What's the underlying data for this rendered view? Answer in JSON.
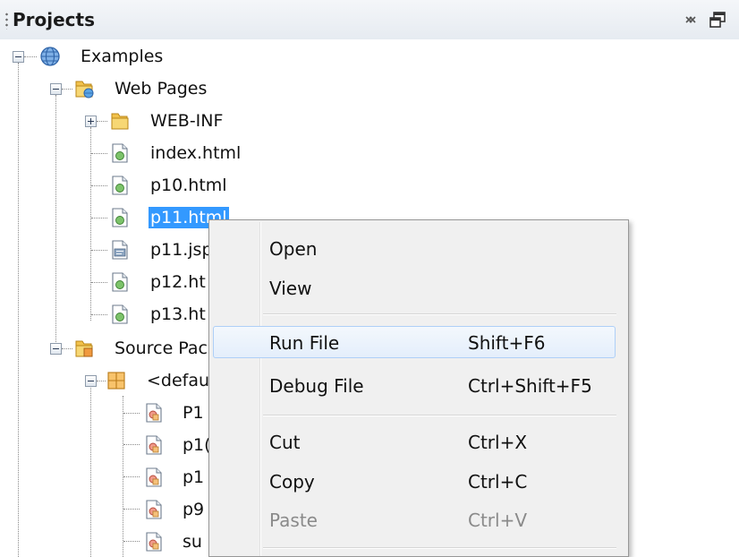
{
  "panel": {
    "title": "Projects",
    "icons": {
      "close": "close-icon",
      "restore": "restore-window-icon"
    }
  },
  "tree": {
    "root": {
      "label": "Examples",
      "icon": "globe-icon"
    },
    "web_pages": {
      "label": "Web Pages",
      "icon": "web-folder-icon"
    },
    "web_files": [
      {
        "label": "WEB-INF",
        "icon": "folder-icon",
        "expandable": true
      },
      {
        "label": "index.html",
        "icon": "html-file-icon"
      },
      {
        "label": "p10.html",
        "icon": "html-file-icon"
      },
      {
        "label": "p11.html",
        "icon": "html-file-icon",
        "selected": true
      },
      {
        "label": "p11.jsp",
        "icon": "jsp-file-icon"
      },
      {
        "label": "p12.ht",
        "icon": "html-file-icon"
      },
      {
        "label": "p13.ht",
        "icon": "html-file-icon"
      }
    ],
    "source_packages": {
      "label": "Source Pac",
      "icon": "source-folder-icon"
    },
    "default_package": {
      "label": "<defau",
      "icon": "package-icon"
    },
    "java_files": [
      {
        "label": "P1",
        "icon": "java-file-icon"
      },
      {
        "label": "p1(",
        "icon": "java-file-icon"
      },
      {
        "label": "p1",
        "icon": "java-file-icon"
      },
      {
        "label": "p9",
        "icon": "java-file-icon"
      },
      {
        "label": "su",
        "icon": "java-file-icon"
      }
    ]
  },
  "context_menu": {
    "items": [
      {
        "label": "Open",
        "shortcut": ""
      },
      {
        "label": "View",
        "shortcut": ""
      },
      {
        "label": "Run File",
        "shortcut": "Shift+F6",
        "highlighted": true
      },
      {
        "label": "Debug File",
        "shortcut": "Ctrl+Shift+F5"
      },
      {
        "label": "Cut",
        "shortcut": "Ctrl+X"
      },
      {
        "label": "Copy",
        "shortcut": "Ctrl+C"
      },
      {
        "label": "Paste",
        "shortcut": "Ctrl+V",
        "disabled": true
      }
    ]
  },
  "colors": {
    "selection": "#3399ff",
    "menu_background": "#f0f0f0",
    "menu_hover_border": "#aecff7"
  }
}
